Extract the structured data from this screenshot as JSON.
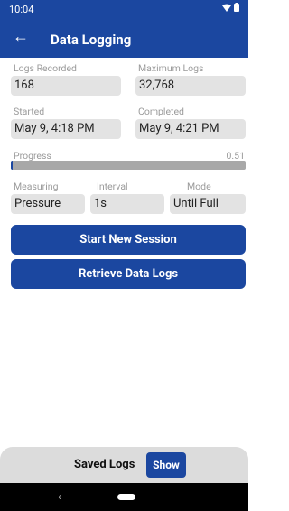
{
  "status_bar": {
    "time": "10:04",
    "icons": [
      "wifi-icon",
      "battery-icon"
    ]
  },
  "app_bar": {
    "title": "Data Logging",
    "back_icon": "arrow-left-icon"
  },
  "fields": {
    "logs_recorded": {
      "label": "Logs Recorded",
      "value": "168"
    },
    "maximum_logs": {
      "label": "Maximum Logs",
      "value": "32,768"
    },
    "started": {
      "label": "Started",
      "value": "May 9, 4:18 PM"
    },
    "completed": {
      "label": "Completed",
      "value": "May 9, 4:21 PM"
    },
    "progress": {
      "label": "Progress",
      "value_text": "0.51",
      "fraction": 0.0051
    },
    "measuring": {
      "label": "Measuring",
      "value": "Pressure"
    },
    "interval": {
      "label": "Interval",
      "value": "1s"
    },
    "mode": {
      "label": "Mode",
      "value": "Until Full"
    }
  },
  "buttons": {
    "start_session": "Start New Session",
    "retrieve_logs": "Retrieve Data Logs"
  },
  "saved_logs": {
    "label": "Saved Logs",
    "show_button": "Show"
  },
  "colors": {
    "primary": "#1b47a0",
    "field_bg": "#e3e3e3",
    "label": "#9a9a9a"
  }
}
